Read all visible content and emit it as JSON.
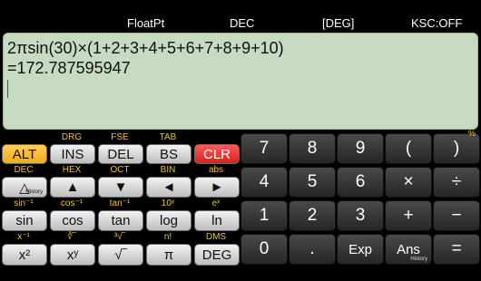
{
  "status": {
    "mode": "FloatPt",
    "base": "DEC",
    "angle": "[DEG]",
    "keyset": "KSC:OFF"
  },
  "display": {
    "expression": "2πsin(30)×(1+2+3+4+5+6+7+8+9+10)",
    "result": "=172.787595947"
  },
  "labels": {
    "row1": [
      "DRG",
      "FSE",
      "TAB"
    ],
    "row2": [
      "DEC",
      "HEX",
      "OCT",
      "BIN",
      "abs"
    ],
    "row3": [
      "sin⁻¹",
      "cos⁻¹",
      "tan⁻¹",
      "10ˣ",
      "eˣ"
    ],
    "row4": [
      "x⁻¹",
      "∛‾",
      "³√‾",
      "n!",
      "DMS"
    ]
  },
  "keys": {
    "alt": "ALT",
    "ins": "INS",
    "del": "DEL",
    "bs": "BS",
    "clr": "CLR",
    "history_sub": "History",
    "sin": "sin",
    "cos": "cos",
    "tan": "tan",
    "log": "log",
    "ln": "ln",
    "sq": "x²",
    "pow": "xʸ",
    "sqrt": "√‾",
    "pi": "π",
    "deg": "DEG",
    "n7": "7",
    "n8": "8",
    "n9": "9",
    "lp": "(",
    "rp": ")",
    "pct": "%",
    "n4": "4",
    "n5": "5",
    "n6": "6",
    "mul": "×",
    "div": "÷",
    "n1": "1",
    "n2": "2",
    "n3": "3",
    "add": "+",
    "sub": "−",
    "n0": "0",
    "dot": ".",
    "exp": "Exp",
    "ans": "Ans",
    "ans_sub": "History",
    "eq": "="
  }
}
